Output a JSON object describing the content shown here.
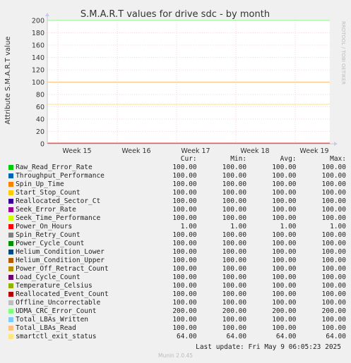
{
  "chart_data": {
    "type": "line",
    "title": "S.M.A.R.T values for drive sdc - by month",
    "ylabel": "Attribute S.M.A.R.T value",
    "watermark": "RRDTOOL / TOBI OETIKER",
    "ylim": [
      0,
      200
    ],
    "yticks": [
      0,
      20,
      40,
      60,
      80,
      100,
      120,
      140,
      160,
      180,
      200
    ],
    "xticks": [
      "Week 15",
      "Week 16",
      "Week 17",
      "Week 18",
      "Week 19"
    ],
    "grid": true,
    "series": [
      {
        "name": "Raw_Read_Error_Rate",
        "color": "#00cc00",
        "values": [
          100,
          100
        ]
      },
      {
        "name": "Throughput_Performance",
        "color": "#0066b3",
        "values": [
          100,
          100
        ]
      },
      {
        "name": "Spin_Up_Time",
        "color": "#ff8000",
        "values": [
          100,
          100
        ]
      },
      {
        "name": "Start_Stop_Count",
        "color": "#ffcc00",
        "values": [
          100,
          100
        ]
      },
      {
        "name": "Reallocated_Sector_Ct",
        "color": "#330099",
        "values": [
          100,
          100
        ]
      },
      {
        "name": "Seek_Error_Rate",
        "color": "#990099",
        "values": [
          100,
          100
        ]
      },
      {
        "name": "Seek_Time_Performance",
        "color": "#ccff00",
        "values": [
          100,
          100
        ]
      },
      {
        "name": "Power_On_Hours",
        "color": "#ff0000",
        "values": [
          1,
          1
        ]
      },
      {
        "name": "Spin_Retry_Count",
        "color": "#808080",
        "values": [
          100,
          100
        ]
      },
      {
        "name": "Power_Cycle_Count",
        "color": "#008f00",
        "values": [
          100,
          100
        ]
      },
      {
        "name": "Helium_Condition_Lower",
        "color": "#00487d",
        "values": [
          100,
          100
        ]
      },
      {
        "name": "Helium_Condition_Upper",
        "color": "#b35a00",
        "values": [
          100,
          100
        ]
      },
      {
        "name": "Power_Off_Retract_Count",
        "color": "#b38f00",
        "values": [
          100,
          100
        ]
      },
      {
        "name": "Load_Cycle_Count",
        "color": "#6b006b",
        "values": [
          100,
          100
        ]
      },
      {
        "name": "Temperature_Celsius",
        "color": "#8fb300",
        "values": [
          100,
          100
        ]
      },
      {
        "name": "Reallocated_Event_Count",
        "color": "#b30000",
        "values": [
          100,
          100
        ]
      },
      {
        "name": "Offline_Uncorrectable",
        "color": "#bebebe",
        "values": [
          100,
          100
        ]
      },
      {
        "name": "UDMA_CRC_Error_Count",
        "color": "#80ff80",
        "values": [
          200,
          200
        ]
      },
      {
        "name": "Total_LBAs_Written",
        "color": "#80c9ff",
        "values": [
          100,
          100
        ]
      },
      {
        "name": "Total_LBAs_Read",
        "color": "#ffc080",
        "values": [
          100,
          100
        ]
      },
      {
        "name": "smartctl_exit_status",
        "color": "#ffe680",
        "values": [
          64,
          64
        ]
      }
    ]
  },
  "legend": {
    "headers": {
      "cur": "Cur:",
      "min": "Min:",
      "avg": "Avg:",
      "max": "Max:"
    },
    "rows": [
      {
        "name": "Raw_Read_Error_Rate",
        "color": "#00cc00",
        "cur": "100.00",
        "min": "100.00",
        "avg": "100.00",
        "max": "100.00"
      },
      {
        "name": "Throughput_Performance",
        "color": "#0066b3",
        "cur": "100.00",
        "min": "100.00",
        "avg": "100.00",
        "max": "100.00"
      },
      {
        "name": "Spin_Up_Time",
        "color": "#ff8000",
        "cur": "100.00",
        "min": "100.00",
        "avg": "100.00",
        "max": "100.00"
      },
      {
        "name": "Start_Stop_Count",
        "color": "#ffcc00",
        "cur": "100.00",
        "min": "100.00",
        "avg": "100.00",
        "max": "100.00"
      },
      {
        "name": "Reallocated_Sector_Ct",
        "color": "#330099",
        "cur": "100.00",
        "min": "100.00",
        "avg": "100.00",
        "max": "100.00"
      },
      {
        "name": "Seek_Error_Rate",
        "color": "#990099",
        "cur": "100.00",
        "min": "100.00",
        "avg": "100.00",
        "max": "100.00"
      },
      {
        "name": "Seek_Time_Performance",
        "color": "#ccff00",
        "cur": "100.00",
        "min": "100.00",
        "avg": "100.00",
        "max": "100.00"
      },
      {
        "name": "Power_On_Hours",
        "color": "#ff0000",
        "cur": "1.00",
        "min": "1.00",
        "avg": "1.00",
        "max": "1.00"
      },
      {
        "name": "Spin_Retry_Count",
        "color": "#808080",
        "cur": "100.00",
        "min": "100.00",
        "avg": "100.00",
        "max": "100.00"
      },
      {
        "name": "Power_Cycle_Count",
        "color": "#008f00",
        "cur": "100.00",
        "min": "100.00",
        "avg": "100.00",
        "max": "100.00"
      },
      {
        "name": "Helium_Condition_Lower",
        "color": "#00487d",
        "cur": "100.00",
        "min": "100.00",
        "avg": "100.00",
        "max": "100.00"
      },
      {
        "name": "Helium_Condition_Upper",
        "color": "#b35a00",
        "cur": "100.00",
        "min": "100.00",
        "avg": "100.00",
        "max": "100.00"
      },
      {
        "name": "Power_Off_Retract_Count",
        "color": "#b38f00",
        "cur": "100.00",
        "min": "100.00",
        "avg": "100.00",
        "max": "100.00"
      },
      {
        "name": "Load_Cycle_Count",
        "color": "#6b006b",
        "cur": "100.00",
        "min": "100.00",
        "avg": "100.00",
        "max": "100.00"
      },
      {
        "name": "Temperature_Celsius",
        "color": "#8fb300",
        "cur": "100.00",
        "min": "100.00",
        "avg": "100.00",
        "max": "100.00"
      },
      {
        "name": "Reallocated_Event_Count",
        "color": "#b30000",
        "cur": "100.00",
        "min": "100.00",
        "avg": "100.00",
        "max": "100.00"
      },
      {
        "name": "Offline_Uncorrectable",
        "color": "#bebebe",
        "cur": "100.00",
        "min": "100.00",
        "avg": "100.00",
        "max": "100.00"
      },
      {
        "name": "UDMA_CRC_Error_Count",
        "color": "#80ff80",
        "cur": "200.00",
        "min": "200.00",
        "avg": "200.00",
        "max": "200.00"
      },
      {
        "name": "Total_LBAs_Written",
        "color": "#80c9ff",
        "cur": "100.00",
        "min": "100.00",
        "avg": "100.00",
        "max": "100.00"
      },
      {
        "name": "Total_LBAs_Read",
        "color": "#ffc080",
        "cur": "100.00",
        "min": "100.00",
        "avg": "100.00",
        "max": "100.00"
      },
      {
        "name": "smartctl_exit_status",
        "color": "#ffe680",
        "cur": "64.00",
        "min": "64.00",
        "avg": "64.00",
        "max": "64.00"
      }
    ]
  },
  "footer": {
    "last_update": "Last update: Fri May  9 06:05:23 2025",
    "version": "Munin 2.0.45"
  }
}
